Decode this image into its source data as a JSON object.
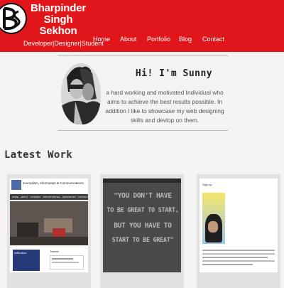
{
  "brand": {
    "name_line1": "Bharpinder Singh",
    "name_line2": "Sekhon",
    "tagline": "Developer|Designer|Student",
    "logo_icon": "bs-monogram-logo"
  },
  "nav": {
    "items": [
      {
        "label": "Home"
      },
      {
        "label": "About"
      },
      {
        "label": "Portfolio"
      },
      {
        "label": "Blog"
      },
      {
        "label": "Contact"
      }
    ]
  },
  "intro": {
    "greeting": "Hi! I'm Sunny",
    "text": "a hard working and motivated Individual who aims to achieve the best results possible. In addition I like to showcase my web designing skills and devlop on them."
  },
  "latest_work": {
    "heading": "Latest Work",
    "cards": [
      {
        "screenshot_title": "Journalism, Information & Communications",
        "menu": [
          "HOME",
          "ABOUT",
          "COURSES",
          "OPPORTUNITIES",
          "RESOURCES",
          "CONTACT"
        ],
        "side_heading": "Tweets",
        "lower_label": "Infiltration",
        "caption": ""
      },
      {
        "quote_lines": [
          "\"YOU DON'T HAVE",
          "TO BE GREAT TO START,",
          "BUT YOU HAVE TO",
          "START TO BE GREAT\""
        ],
        "caption": ""
      },
      {
        "screenshot_title": "Sign up",
        "caption": ""
      }
    ]
  },
  "colors": {
    "header_red": "#e0161b",
    "background": "#f3f3f3",
    "card_bg": "#e2e2e2"
  }
}
